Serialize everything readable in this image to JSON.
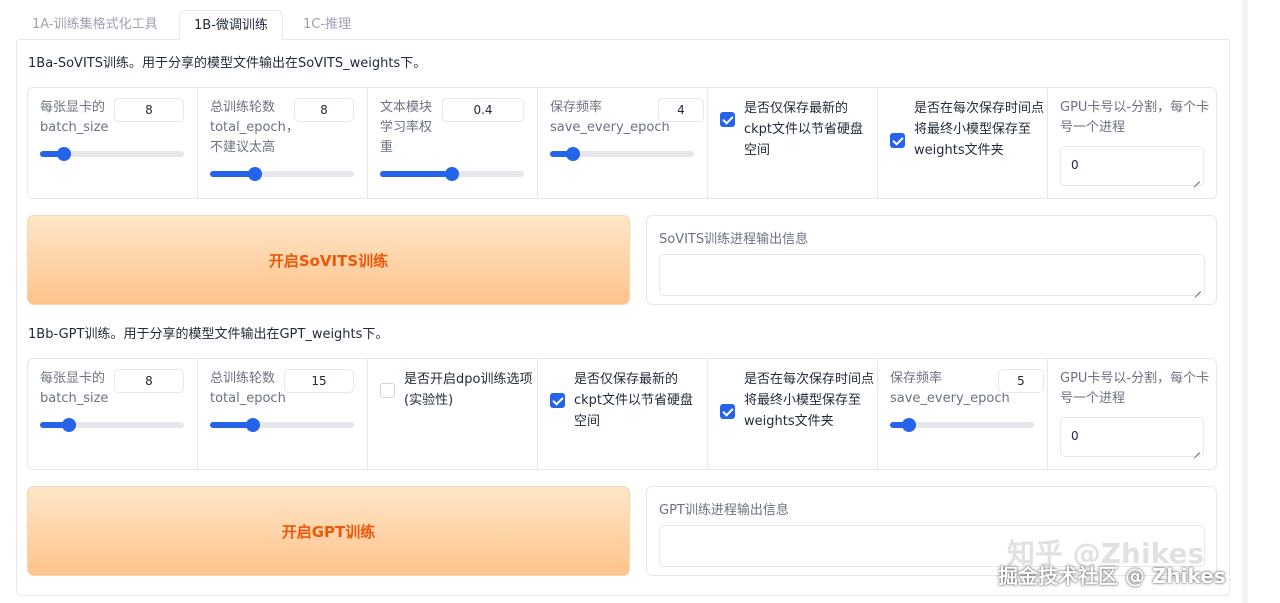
{
  "tabs": [
    {
      "label": "1A-训练集格式化工具",
      "active": false
    },
    {
      "label": "1B-微调训练",
      "active": true
    },
    {
      "label": "1C-推理",
      "active": false
    }
  ],
  "sovits": {
    "title": "1Ba-SoVITS训练。用于分享的模型文件输出在SoVITS_weights下。",
    "batch_size": {
      "label": "每张显卡的batch_size",
      "value": "8",
      "fraction": 0.17
    },
    "total_epoch": {
      "label": "总训练轮数total_epoch，不建议太高",
      "value": "8",
      "fraction": 0.31
    },
    "text_lr": {
      "label": "文本模块学习率权重",
      "value": "0.4",
      "fraction": 0.5
    },
    "save_every": {
      "label": "保存频率save_every_epoch",
      "value": "4",
      "fraction": 0.16
    },
    "save_latest": {
      "label": "是否仅保存最新的ckpt文件以节省硬盘空间",
      "checked": true
    },
    "save_small": {
      "label": "是否在每次保存时间点将最终小模型保存至weights文件夹",
      "checked": true
    },
    "gpu": {
      "label": "GPU卡号以-分割，每个卡号一个进程",
      "value": "0"
    },
    "start_button": "开启SoVITS训练",
    "output_label": "SoVITS训练进程输出信息"
  },
  "gpt": {
    "title": "1Bb-GPT训练。用于分享的模型文件输出在GPT_weights下。",
    "batch_size": {
      "label": "每张显卡的batch_size",
      "value": "8",
      "fraction": 0.2
    },
    "total_epoch": {
      "label": "总训练轮数total_epoch",
      "value": "15",
      "fraction": 0.3
    },
    "dpo": {
      "label": "是否开启dpo训练选项(实验性)",
      "checked": false
    },
    "save_latest": {
      "label": "是否仅保存最新的ckpt文件以节省硬盘空间",
      "checked": true
    },
    "save_small": {
      "label": "是否在每次保存时间点将最终小模型保存至weights文件夹",
      "checked": true
    },
    "save_every": {
      "label": "保存频率save_every_epoch",
      "value": "5",
      "fraction": 0.13
    },
    "gpu": {
      "label": "GPU卡号以-分割，每个卡号一个进程",
      "value": "0"
    },
    "start_button": "开启GPT训练",
    "output_label": "GPT训练进程输出信息"
  },
  "watermark": {
    "upper": "知乎 @Zhikes",
    "lower": "掘金技术社区 @ Zhikes"
  },
  "colors": {
    "accent": "#2563eb",
    "button_text": "#ea580c",
    "button_bg": "#fdc38b"
  }
}
